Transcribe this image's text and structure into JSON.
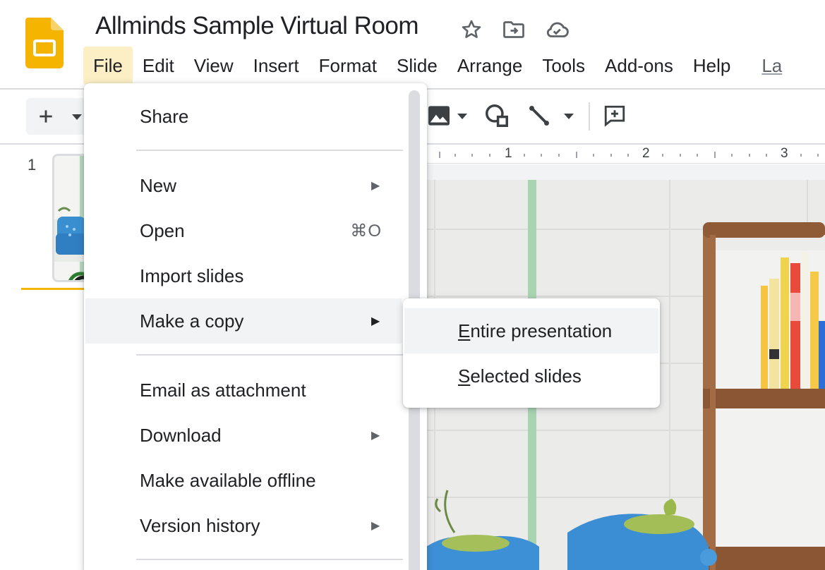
{
  "app": {
    "title": "Allminds Sample Virtual Room",
    "accent_color": "#f4b400",
    "logo_icon": "google-slides-logo-icon",
    "title_icons": [
      "star-icon",
      "move-to-folder-icon",
      "cloud-saved-icon"
    ]
  },
  "menubar": {
    "items": [
      "File",
      "Edit",
      "View",
      "Insert",
      "Format",
      "Slide",
      "Arrange",
      "Tools",
      "Add-ons",
      "Help"
    ],
    "active": "File",
    "last_edit_link": "La"
  },
  "toolbar": {
    "icons": [
      "add-icon",
      "dropdown-arrow-icon",
      "image-icon",
      "dropdown-arrow-icon",
      "shape-icon",
      "line-icon",
      "dropdown-arrow-icon",
      "add-comment-icon"
    ]
  },
  "filmstrip": {
    "slide_number": "1"
  },
  "ruler": {
    "marks": [
      "1",
      "2",
      "3"
    ]
  },
  "file_menu": {
    "share": "Share",
    "new": "New",
    "open": "Open",
    "open_shortcut": "⌘O",
    "import_slides": "Import slides",
    "make_a_copy": "Make a copy",
    "email_as_attachment": "Email as attachment",
    "download": "Download",
    "make_available_offline": "Make available offline",
    "version_history": "Version history",
    "submenu_arrow": "▶"
  },
  "copy_submenu": {
    "entire_mnemonic": "E",
    "entire_rest": "ntire presentation",
    "selected_mnemonic": "S",
    "selected_rest": "elected slides"
  }
}
